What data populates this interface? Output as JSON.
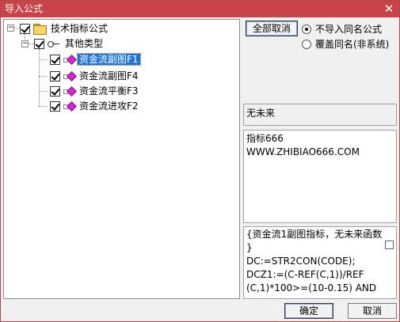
{
  "window": {
    "title": "导入公式",
    "close_glyph": "✕"
  },
  "tree": {
    "root": {
      "label": "技术指标公式",
      "expander": "−"
    },
    "group": {
      "label": "其他类型",
      "expander": "−"
    },
    "items": [
      {
        "label": "资金流副图F1",
        "selected": true
      },
      {
        "label": "资金流副图F4",
        "selected": false
      },
      {
        "label": "资金流平衡F3",
        "selected": false
      },
      {
        "label": "资金流进攻F2",
        "selected": false
      }
    ]
  },
  "options": {
    "cancel_all_label": "全部取消",
    "radio_no_import": "不导入同名公式",
    "radio_overwrite": "覆盖同名(非系统)"
  },
  "info": {
    "future_text": "无未来",
    "description_lines": [
      "指标666",
      "WWW.ZHIBIAO666.COM"
    ],
    "code_lines": [
      "{资金流1副图指标，无未来函数",
      "}",
      "DC:=STR2CON(CODE);",
      "DCZ1:=(C-REF(C,1))/REF",
      "(C,1)*100>=(10-0.15) AND"
    ]
  },
  "footer": {
    "ok_label": "确定",
    "cancel_label": "取消"
  }
}
